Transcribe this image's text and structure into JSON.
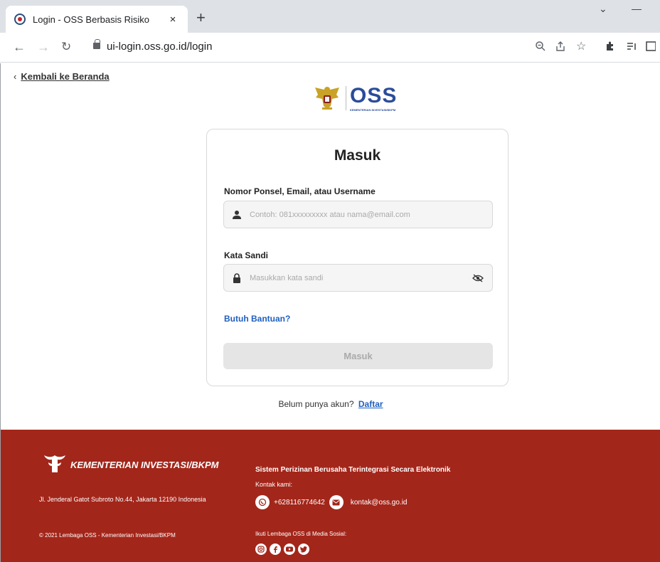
{
  "browser": {
    "tab_title": "Login - OSS Berbasis Risiko",
    "tab_close": "×",
    "new_tab": "+",
    "url": "ui-login.oss.go.id/login",
    "icons": [
      "back-arrow-icon",
      "forward-arrow-icon",
      "reload-icon",
      "lock-icon",
      "zoom-icon",
      "share-icon",
      "star-icon",
      "extensions-icon",
      "reading-list-icon",
      "sidepanel-icon"
    ]
  },
  "page": {
    "back_link": "Kembali ke Beranda",
    "logo_text": "OSS",
    "logo_sub": "KEMENTERIAN INVESTASI/BKPM"
  },
  "login": {
    "title": "Masuk",
    "username_label": "Nomor Ponsel, Email, atau Username",
    "username_placeholder": "Contoh: 081xxxxxxxxx atau nama@email.com",
    "password_label": "Kata Sandi",
    "password_placeholder": "Masukkan kata sandi",
    "help_link": "Butuh Bantuan?",
    "submit_label": "Masuk",
    "register_prompt": "Belum punya akun?",
    "register_link": "Daftar"
  },
  "footer": {
    "brand": "KEMENTERIAN INVESTASI/BKPM",
    "address": "Jl. Jenderal Gatot Subroto No.44, Jakarta 12190 Indonesia",
    "copyright": "© 2021 Lembaga OSS - Kementerian Investasi/BKPM",
    "system_name": "Sistem Perizinan Berusaha Terintegrasi Secara Elektronik",
    "contact_heading": "Kontak kami:",
    "phone": "+628116774642",
    "email": "kontak@oss.go.id",
    "follow_text": "Ikuti Lembaga OSS di Media Sosial:"
  },
  "colors": {
    "footer_bg": "#a3261a",
    "link_blue": "#1f5fbf",
    "oss_blue": "#2b4c9b"
  }
}
